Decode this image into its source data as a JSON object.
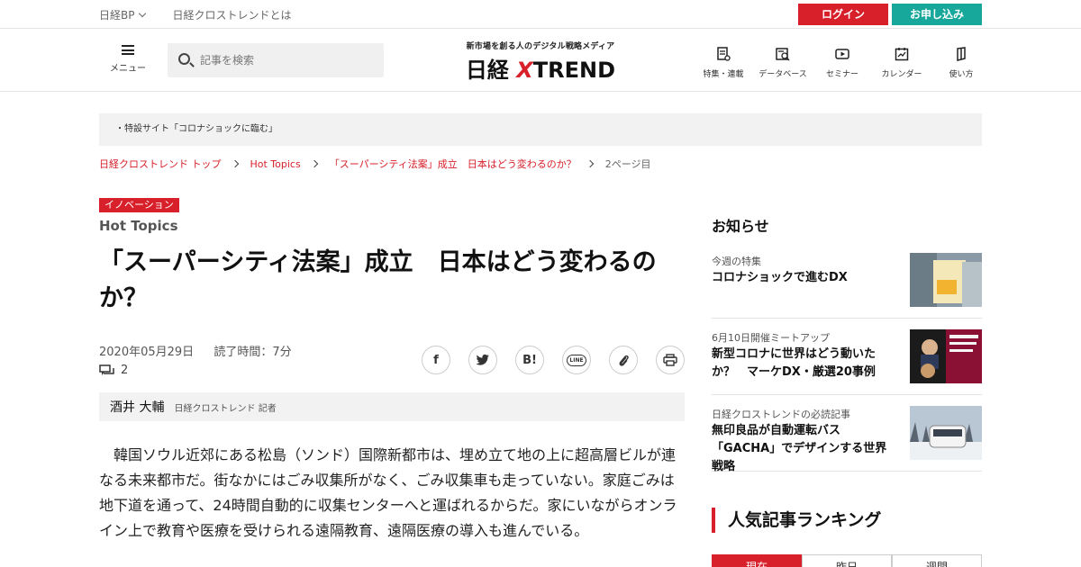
{
  "topbar": {
    "bp_label": "日経BP",
    "about_link": "日経クロストレンドとは",
    "login_label": "ログイン",
    "apply_label": "お申し込み"
  },
  "header": {
    "menu_label": "メニュー",
    "search_placeholder": "記事を検索",
    "logo_tagline": "新市場を創る人のデジタル戦略メディア",
    "logo_name_a": "日経 ",
    "logo_name_x": "X",
    "logo_name_b": "TREND",
    "nav": [
      {
        "label": "特集・連載",
        "icon": "feature-icon"
      },
      {
        "label": "データベース",
        "icon": "database-icon"
      },
      {
        "label": "セミナー",
        "icon": "seminar-icon"
      },
      {
        "label": "カレンダー",
        "icon": "calendar-icon"
      },
      {
        "label": "使い方",
        "icon": "guide-icon"
      }
    ]
  },
  "notice": "・特設サイト「コロナショックに臨む」",
  "breadcrumb": {
    "items": [
      "日経クロストレンド トップ",
      "Hot Topics",
      "「スーパーシティ法案」成立　日本はどう変わるのか？"
    ],
    "current": "2ページ目"
  },
  "article": {
    "category": "イノベーション",
    "kicker": "Hot Topics",
    "title": "「スーパーシティ法案」成立　日本はどう変わるのか？",
    "date": "2020年05月29日",
    "read_time": "読了時間：7分",
    "comment_count": "2",
    "author_name": "酒井 大輔",
    "author_role": "日経クロストレンド 記者",
    "body": "韓国ソウル近郊にある松島（ソンド）国際新都市は、埋め立て地の上に超高層ビルが連なる未来都市だ。街なかにはごみ収集所がなく、ごみ収集車も走っていない。家庭ごみは地下道を通って、24時間自動的に収集センターへと運ばれるからだ。家にいながらオンライン上で教育や医療を受けられる遠隔教育、遠隔医療の導入も進んでいる。"
  },
  "share": {
    "facebook": "f",
    "hatena": "B!",
    "line": "LINE"
  },
  "sidebar": {
    "news_heading": "お知らせ",
    "news": [
      {
        "label": "今週の特集",
        "headline": "コロナショックで進むDX"
      },
      {
        "label": "6月10日開催ミートアップ",
        "headline": "新型コロナに世界はどう動いたか？　マーケDX・厳選20事例"
      },
      {
        "label": "日経クロストレンドの必読記事",
        "headline": "無印良品が自動運転バス「GACHA」でデザインする世界戦略"
      }
    ],
    "ranking_heading": "人気記事ランキング",
    "ranking_tabs": [
      "現在",
      "昨日",
      "週間"
    ]
  },
  "colors": {
    "accent_red": "#d7202a",
    "accent_teal": "#18a79b"
  }
}
